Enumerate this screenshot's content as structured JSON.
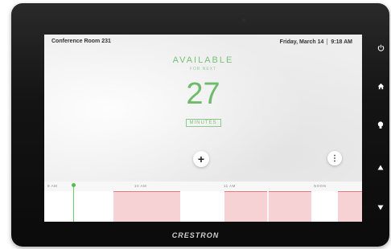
{
  "header": {
    "room_name": "Conference Room 231",
    "date": "Friday, March 14",
    "time": "9:18 AM"
  },
  "status": {
    "title": "AVAILABLE",
    "subtitle": "FOR NEXT",
    "count": "27",
    "unit": "MINUTES"
  },
  "actions": {
    "add_symbol": "+",
    "more_symbol": "⋮"
  },
  "timeline": {
    "labels": [
      "9 AM",
      "10 AM",
      "11 AM",
      "NOON"
    ],
    "blocks": [
      {
        "state": "free"
      },
      {
        "state": "free"
      },
      {
        "state": "busy"
      },
      {
        "state": "free"
      },
      {
        "state": "busy"
      },
      {
        "state": "busy"
      },
      {
        "state": "free"
      },
      {
        "state": "busy"
      }
    ]
  },
  "side_buttons": [
    "power-icon",
    "home-icon",
    "light-icon",
    "up-icon",
    "down-icon"
  ],
  "brand": "CRESTRON",
  "colors": {
    "available": "#6dbb6b",
    "busy": "#f6d2d4",
    "busy_edge": "#e07c82"
  }
}
